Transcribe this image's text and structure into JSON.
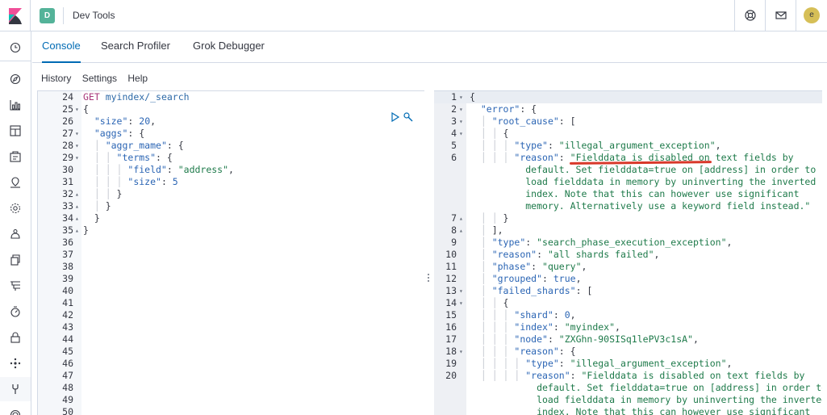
{
  "header": {
    "space_initial": "D",
    "app_title": "Dev Tools",
    "user_initial": "e"
  },
  "tabs": [
    "Console",
    "Search Profiler",
    "Grok Debugger"
  ],
  "submenu": [
    "History",
    "Settings",
    "Help"
  ],
  "nav_icons": [
    "clock-icon",
    "discover-icon",
    "visualize-icon",
    "dashboard-icon",
    "canvas-icon",
    "maps-icon",
    "ml-icon",
    "metrics-icon",
    "logs-icon",
    "apm-icon",
    "uptime-icon",
    "security-icon",
    "monitoring-icon",
    "devtools-icon",
    "management-icon"
  ],
  "request_lines": [
    {
      "n": "24",
      "fold": "",
      "tokens": [
        {
          "t": "GET",
          "c": "k-method"
        },
        {
          "t": " myindex/_search",
          "c": "k-url"
        }
      ]
    },
    {
      "n": "25",
      "fold": "▾",
      "tokens": [
        {
          "t": "{",
          "c": "k-p"
        }
      ]
    },
    {
      "n": "26",
      "fold": "",
      "tokens": [
        {
          "t": "  ",
          "c": "k-p"
        },
        {
          "t": "\"size\"",
          "c": "k-key"
        },
        {
          "t": ": ",
          "c": "k-p"
        },
        {
          "t": "20",
          "c": "k-num"
        },
        {
          "t": ",",
          "c": "k-p"
        }
      ]
    },
    {
      "n": "27",
      "fold": "▾",
      "tokens": [
        {
          "t": "  ",
          "c": "k-p"
        },
        {
          "t": "\"aggs\"",
          "c": "k-key"
        },
        {
          "t": ": {",
          "c": "k-p"
        }
      ]
    },
    {
      "n": "28",
      "fold": "▾",
      "tokens": [
        {
          "t": "  │ ",
          "c": "guide"
        },
        {
          "t": "\"aggr_mame\"",
          "c": "k-key"
        },
        {
          "t": ": {",
          "c": "k-p"
        }
      ]
    },
    {
      "n": "29",
      "fold": "▾",
      "tokens": [
        {
          "t": "  │ │ ",
          "c": "guide"
        },
        {
          "t": "\"terms\"",
          "c": "k-key"
        },
        {
          "t": ": {",
          "c": "k-p"
        }
      ]
    },
    {
      "n": "30",
      "fold": "",
      "tokens": [
        {
          "t": "  │ │ │ ",
          "c": "guide"
        },
        {
          "t": "\"field\"",
          "c": "k-key"
        },
        {
          "t": ": ",
          "c": "k-p"
        },
        {
          "t": "\"address\"",
          "c": "k-str"
        },
        {
          "t": ",",
          "c": "k-p"
        }
      ]
    },
    {
      "n": "31",
      "fold": "",
      "tokens": [
        {
          "t": "  │ │ │ ",
          "c": "guide"
        },
        {
          "t": "\"size\"",
          "c": "k-key"
        },
        {
          "t": ": ",
          "c": "k-p"
        },
        {
          "t": "5",
          "c": "k-num"
        }
      ]
    },
    {
      "n": "32",
      "fold": "▴",
      "tokens": [
        {
          "t": "  │ │ ",
          "c": "guide"
        },
        {
          "t": "}",
          "c": "k-p"
        }
      ]
    },
    {
      "n": "33",
      "fold": "▴",
      "tokens": [
        {
          "t": "  │ ",
          "c": "guide"
        },
        {
          "t": "}",
          "c": "k-p"
        }
      ]
    },
    {
      "n": "34",
      "fold": "▴",
      "tokens": [
        {
          "t": "  }",
          "c": "k-p"
        }
      ]
    },
    {
      "n": "35",
      "fold": "▴",
      "tokens": [
        {
          "t": "}",
          "c": "k-p"
        }
      ]
    },
    {
      "n": "36",
      "fold": "",
      "tokens": []
    },
    {
      "n": "37",
      "fold": "",
      "tokens": []
    },
    {
      "n": "38",
      "fold": "",
      "tokens": []
    },
    {
      "n": "39",
      "fold": "",
      "tokens": []
    },
    {
      "n": "40",
      "fold": "",
      "tokens": []
    },
    {
      "n": "41",
      "fold": "",
      "tokens": []
    },
    {
      "n": "42",
      "fold": "",
      "tokens": []
    },
    {
      "n": "43",
      "fold": "",
      "tokens": []
    },
    {
      "n": "44",
      "fold": "",
      "tokens": []
    },
    {
      "n": "45",
      "fold": "",
      "tokens": []
    },
    {
      "n": "46",
      "fold": "",
      "tokens": []
    },
    {
      "n": "47",
      "fold": "",
      "tokens": []
    },
    {
      "n": "48",
      "fold": "",
      "tokens": []
    },
    {
      "n": "49",
      "fold": "",
      "tokens": []
    },
    {
      "n": "50",
      "fold": "",
      "tokens": []
    }
  ],
  "response_lines": [
    {
      "n": "1",
      "fold": "▾",
      "tokens": [
        {
          "t": "{",
          "c": "k-p"
        }
      ]
    },
    {
      "n": "2",
      "fold": "▾",
      "tokens": [
        {
          "t": "  ",
          "c": "k-p"
        },
        {
          "t": "\"error\"",
          "c": "k-key"
        },
        {
          "t": ": {",
          "c": "k-p"
        }
      ]
    },
    {
      "n": "3",
      "fold": "▾",
      "tokens": [
        {
          "t": "  │ ",
          "c": "guide"
        },
        {
          "t": "\"root_cause\"",
          "c": "k-key"
        },
        {
          "t": ": [",
          "c": "k-p"
        }
      ]
    },
    {
      "n": "4",
      "fold": "▾",
      "tokens": [
        {
          "t": "  │ │ ",
          "c": "guide"
        },
        {
          "t": "{",
          "c": "k-p"
        }
      ]
    },
    {
      "n": "5",
      "fold": "",
      "tokens": [
        {
          "t": "  │ │ │ ",
          "c": "guide"
        },
        {
          "t": "\"type\"",
          "c": "k-key"
        },
        {
          "t": ": ",
          "c": "k-p"
        },
        {
          "t": "\"illegal_argument_exception\"",
          "c": "k-str"
        },
        {
          "t": ",",
          "c": "k-p"
        }
      ]
    },
    {
      "n": "6",
      "fold": "",
      "tokens": [
        {
          "t": "  │ │ │ ",
          "c": "guide"
        },
        {
          "t": "\"reason\"",
          "c": "k-key"
        },
        {
          "t": ": ",
          "c": "k-p"
        },
        {
          "t": "\"Fielddata is disabled on text fields by",
          "c": "k-str"
        }
      ]
    },
    {
      "n": "",
      "fold": "",
      "tokens": [
        {
          "t": "          default. Set fielddata=true on [address] in order to",
          "c": "k-str"
        }
      ]
    },
    {
      "n": "",
      "fold": "",
      "tokens": [
        {
          "t": "          load fielddata in memory by uninverting the inverted",
          "c": "k-str"
        }
      ]
    },
    {
      "n": "",
      "fold": "",
      "tokens": [
        {
          "t": "          index. Note that this can however use significant",
          "c": "k-str"
        }
      ]
    },
    {
      "n": "",
      "fold": "",
      "tokens": [
        {
          "t": "          memory. Alternatively use a keyword field instead.\"",
          "c": "k-str"
        }
      ]
    },
    {
      "n": "7",
      "fold": "▴",
      "tokens": [
        {
          "t": "  │ │ ",
          "c": "guide"
        },
        {
          "t": "}",
          "c": "k-p"
        }
      ]
    },
    {
      "n": "8",
      "fold": "▴",
      "tokens": [
        {
          "t": "  │ ",
          "c": "guide"
        },
        {
          "t": "],",
          "c": "k-p"
        }
      ]
    },
    {
      "n": "9",
      "fold": "",
      "tokens": [
        {
          "t": "  │ ",
          "c": "guide"
        },
        {
          "t": "\"type\"",
          "c": "k-key"
        },
        {
          "t": ": ",
          "c": "k-p"
        },
        {
          "t": "\"search_phase_execution_exception\"",
          "c": "k-str"
        },
        {
          "t": ",",
          "c": "k-p"
        }
      ]
    },
    {
      "n": "10",
      "fold": "",
      "tokens": [
        {
          "t": "  │ ",
          "c": "guide"
        },
        {
          "t": "\"reason\"",
          "c": "k-key"
        },
        {
          "t": ": ",
          "c": "k-p"
        },
        {
          "t": "\"all shards failed\"",
          "c": "k-str"
        },
        {
          "t": ",",
          "c": "k-p"
        }
      ]
    },
    {
      "n": "11",
      "fold": "",
      "tokens": [
        {
          "t": "  │ ",
          "c": "guide"
        },
        {
          "t": "\"phase\"",
          "c": "k-key"
        },
        {
          "t": ": ",
          "c": "k-p"
        },
        {
          "t": "\"query\"",
          "c": "k-str"
        },
        {
          "t": ",",
          "c": "k-p"
        }
      ]
    },
    {
      "n": "12",
      "fold": "",
      "tokens": [
        {
          "t": "  │ ",
          "c": "guide"
        },
        {
          "t": "\"grouped\"",
          "c": "k-key"
        },
        {
          "t": ": ",
          "c": "k-p"
        },
        {
          "t": "true",
          "c": "k-bool"
        },
        {
          "t": ",",
          "c": "k-p"
        }
      ]
    },
    {
      "n": "13",
      "fold": "▾",
      "tokens": [
        {
          "t": "  │ ",
          "c": "guide"
        },
        {
          "t": "\"failed_shards\"",
          "c": "k-key"
        },
        {
          "t": ": [",
          "c": "k-p"
        }
      ]
    },
    {
      "n": "14",
      "fold": "▾",
      "tokens": [
        {
          "t": "  │ │ ",
          "c": "guide"
        },
        {
          "t": "{",
          "c": "k-p"
        }
      ]
    },
    {
      "n": "15",
      "fold": "",
      "tokens": [
        {
          "t": "  │ │ │ ",
          "c": "guide"
        },
        {
          "t": "\"shard\"",
          "c": "k-key"
        },
        {
          "t": ": ",
          "c": "k-p"
        },
        {
          "t": "0",
          "c": "k-num"
        },
        {
          "t": ",",
          "c": "k-p"
        }
      ]
    },
    {
      "n": "16",
      "fold": "",
      "tokens": [
        {
          "t": "  │ │ │ ",
          "c": "guide"
        },
        {
          "t": "\"index\"",
          "c": "k-key"
        },
        {
          "t": ": ",
          "c": "k-p"
        },
        {
          "t": "\"myindex\"",
          "c": "k-str"
        },
        {
          "t": ",",
          "c": "k-p"
        }
      ]
    },
    {
      "n": "17",
      "fold": "",
      "tokens": [
        {
          "t": "  │ │ │ ",
          "c": "guide"
        },
        {
          "t": "\"node\"",
          "c": "k-key"
        },
        {
          "t": ": ",
          "c": "k-p"
        },
        {
          "t": "\"ZXGhn-90SISq1lePV3c1sA\"",
          "c": "k-str"
        },
        {
          "t": ",",
          "c": "k-p"
        }
      ]
    },
    {
      "n": "18",
      "fold": "▾",
      "tokens": [
        {
          "t": "  │ │ │ ",
          "c": "guide"
        },
        {
          "t": "\"reason\"",
          "c": "k-key"
        },
        {
          "t": ": {",
          "c": "k-p"
        }
      ]
    },
    {
      "n": "19",
      "fold": "",
      "tokens": [
        {
          "t": "  │ │ │ │ ",
          "c": "guide"
        },
        {
          "t": "\"type\"",
          "c": "k-key"
        },
        {
          "t": ": ",
          "c": "k-p"
        },
        {
          "t": "\"illegal_argument_exception\"",
          "c": "k-str"
        },
        {
          "t": ",",
          "c": "k-p"
        }
      ]
    },
    {
      "n": "20",
      "fold": "",
      "tokens": [
        {
          "t": "  │ │ │ │ ",
          "c": "guide"
        },
        {
          "t": "\"reason\"",
          "c": "k-key"
        },
        {
          "t": ": ",
          "c": "k-p"
        },
        {
          "t": "\"Fielddata is disabled on text fields by",
          "c": "k-str"
        }
      ]
    },
    {
      "n": "",
      "fold": "",
      "tokens": [
        {
          "t": "            default. Set fielddata=true on [address] in order to",
          "c": "k-str"
        }
      ]
    },
    {
      "n": "",
      "fold": "",
      "tokens": [
        {
          "t": "            load fielddata in memory by uninverting the inverted",
          "c": "k-str"
        }
      ]
    },
    {
      "n": "",
      "fold": "",
      "tokens": [
        {
          "t": "            index. Note that this can however use significant",
          "c": "k-str"
        }
      ]
    }
  ]
}
